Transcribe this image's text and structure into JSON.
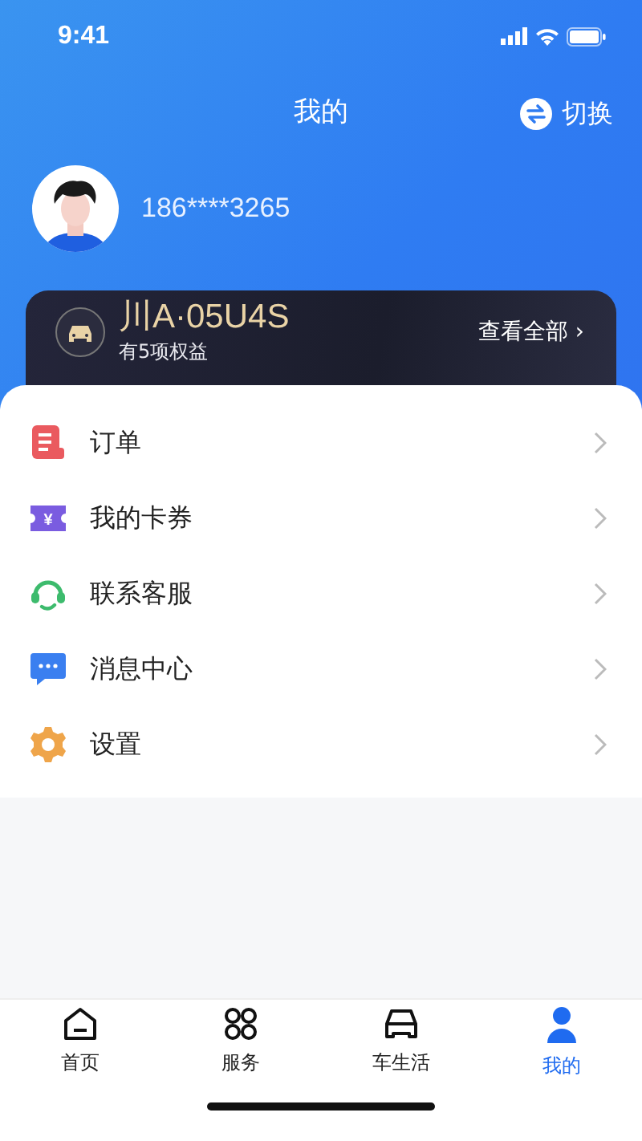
{
  "status_bar": {
    "time": "9:41"
  },
  "header": {
    "title": "我的",
    "switch_label": "切换"
  },
  "profile": {
    "phone": "186****3265"
  },
  "vehicle_card": {
    "plate": "川A·05U4S",
    "benefits": "有5项权益",
    "view_all": "查看全部",
    "chevron": "›"
  },
  "menu": [
    {
      "kind": "order",
      "label": "订单"
    },
    {
      "kind": "coupon",
      "label": "我的卡券",
      "icon_text": "¥"
    },
    {
      "kind": "service",
      "label": "联系客服"
    },
    {
      "kind": "message",
      "label": "消息中心"
    },
    {
      "kind": "settings",
      "label": "设置"
    }
  ],
  "tab_bar": [
    {
      "kind": "home",
      "label": "首页",
      "selected": false
    },
    {
      "kind": "services",
      "label": "服务",
      "selected": false
    },
    {
      "kind": "car",
      "label": "车生活",
      "selected": false
    },
    {
      "kind": "me",
      "label": "我的",
      "selected": true
    }
  ]
}
